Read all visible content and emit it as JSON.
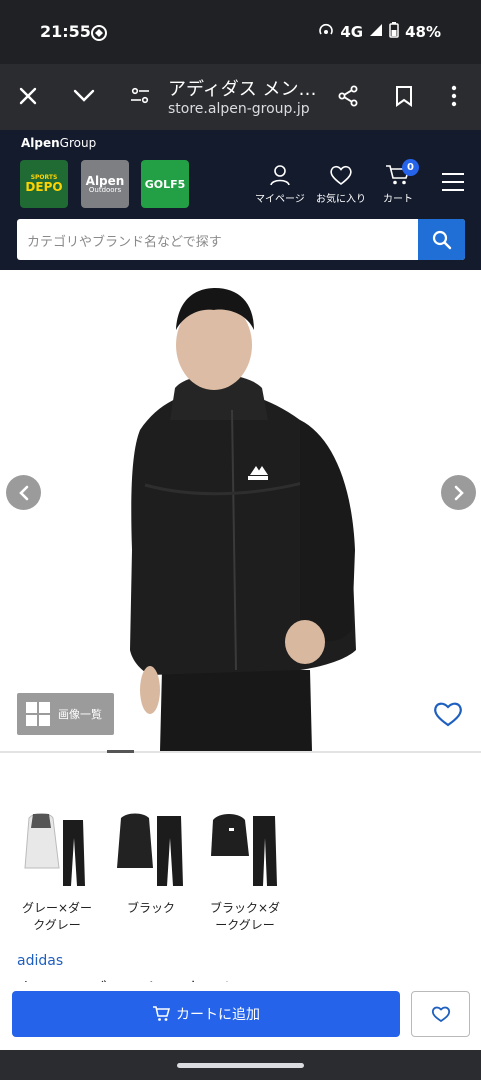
{
  "status_bar": {
    "time": "21:55",
    "network": "4G",
    "battery": "48%",
    "icons": [
      "hotspot-icon",
      "signal-icon",
      "battery-icon"
    ]
  },
  "browser": {
    "title": "アディダス メン…",
    "url": "store.alpen-group.jp",
    "icons": [
      "close-icon",
      "chevron-down-icon",
      "page-info-icon",
      "share-icon",
      "bookmark-icon",
      "overflow-menu-icon"
    ]
  },
  "site": {
    "brand_bold": "Alpen",
    "brand_rest": "Group",
    "logos": {
      "depo_top": "SPORTS",
      "depo_main": "DEPO",
      "outdoors_main": "Alpen",
      "outdoors_sub": "Outdoors",
      "golf5": "GOLF5"
    },
    "header_buttons": {
      "mypage": "マイページ",
      "favorites": "お気に入り",
      "cart": "カート",
      "cart_count": "0"
    },
    "search": {
      "placeholder": "カテゴリやブランド名などで探す"
    }
  },
  "product": {
    "gallery_button": "画像一覧",
    "variants": [
      {
        "label_line1": "グレー×ダー",
        "label_line2": "クグレー"
      },
      {
        "label_line1": "ブラック",
        "label_line2": ""
      },
      {
        "label_line1": "ブラック×ダ",
        "label_line2": "ークグレー"
      }
    ],
    "maker": "adidas",
    "name_partial": "ウインドブレーカー 上下セット"
  },
  "actions": {
    "add_to_cart": "カートに追加"
  },
  "colors": {
    "status_bg": "#202124",
    "toolbar_bg": "#2b2c2f",
    "site_header_bg": "#141b2d",
    "accent_blue": "#2563eb",
    "search_button": "#1f6fd6",
    "maker_link": "#1f5fbf"
  }
}
